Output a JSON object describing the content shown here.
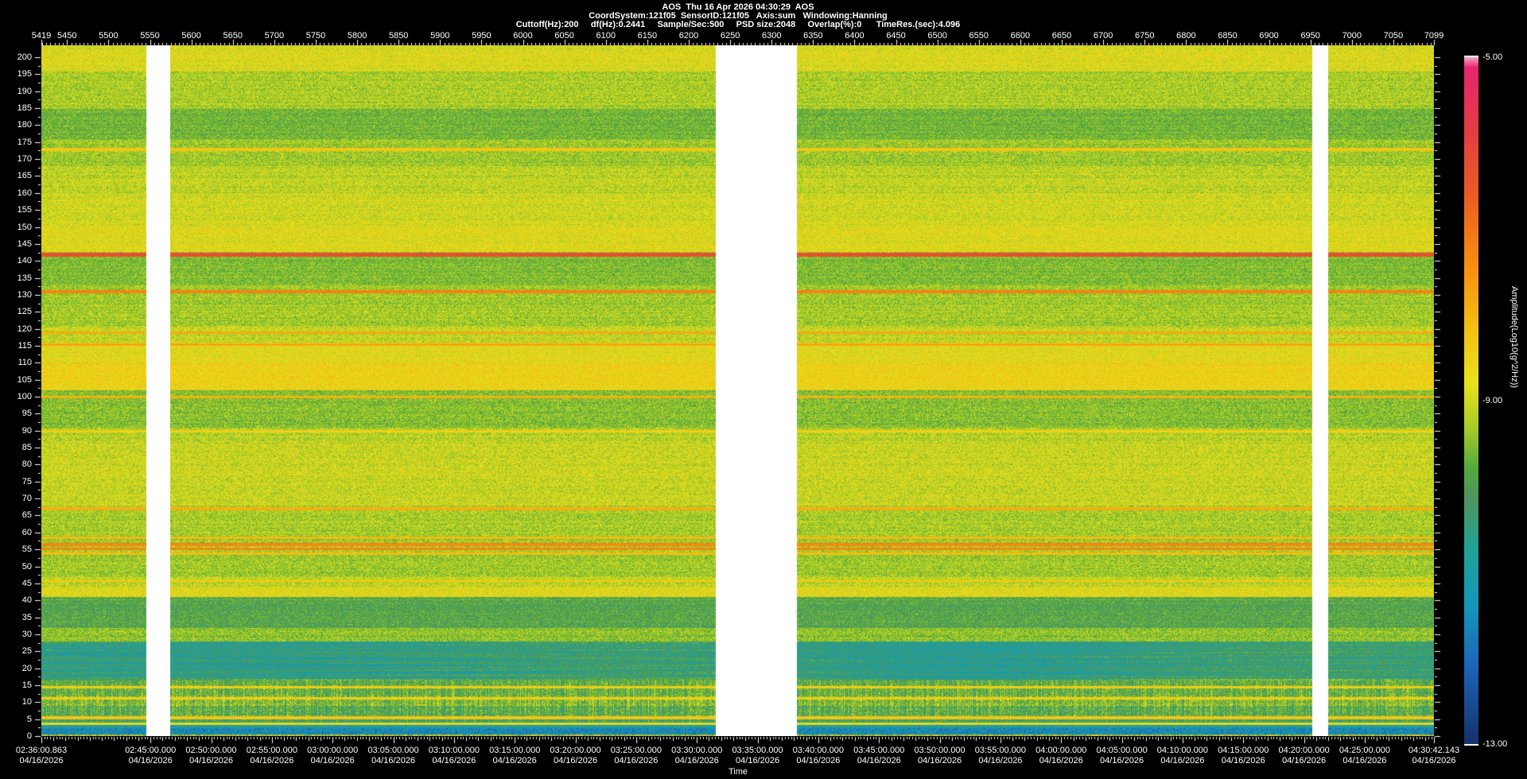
{
  "header": {
    "line1": "AOS  Thu 16 Apr 2026 04:30:29  AOS",
    "line2": "CoordSystem:121f05  SensorID:121f05   Axis:sum   Windowing:Hanning",
    "line3": "Cuttoff(Hz):200     df(Hz):0.2441     Sample/Sec:500     PSD size:2048     Overlap(%):0      TimeRes.(sec):4.096"
  },
  "chart_data": {
    "type": "heatmap",
    "title": "AOS  Thu 16 Apr 2026 04:30:29  AOS",
    "x_axis_top": {
      "min": 5419,
      "max": 7099,
      "labels": [
        5419,
        5450,
        5500,
        5550,
        5600,
        5650,
        5700,
        5750,
        5800,
        5850,
        5900,
        5950,
        6000,
        6050,
        6100,
        6150,
        6200,
        6250,
        6300,
        6350,
        6400,
        6450,
        6500,
        6550,
        6600,
        6650,
        6700,
        6750,
        6800,
        6850,
        6900,
        6950,
        7000,
        7050,
        7099
      ]
    },
    "y_axis": {
      "min": 0,
      "max": 200,
      "labels": [
        200,
        195,
        190,
        185,
        180,
        175,
        170,
        165,
        160,
        155,
        150,
        145,
        140,
        135,
        130,
        125,
        120,
        115,
        110,
        105,
        100,
        95,
        90,
        85,
        80,
        75,
        70,
        65,
        60,
        55,
        50,
        45,
        40,
        35,
        30,
        25,
        20,
        15,
        10,
        5,
        0
      ]
    },
    "x_axis_bottom": {
      "label": "Time",
      "date": "04/16/2026",
      "start_sec": 9360.863,
      "end_sec": 16242.143,
      "tick_labels": [
        {
          "time": "02:36:00.863",
          "sec": 9360.863
        },
        {
          "time": "02:45:00.000",
          "sec": 9900
        },
        {
          "time": "02:50:00.000",
          "sec": 10200
        },
        {
          "time": "02:55:00.000",
          "sec": 10500
        },
        {
          "time": "03:00:00.000",
          "sec": 10800
        },
        {
          "time": "03:05:00.000",
          "sec": 11100
        },
        {
          "time": "03:10:00.000",
          "sec": 11400
        },
        {
          "time": "03:15:00.000",
          "sec": 11700
        },
        {
          "time": "03:20:00.000",
          "sec": 12000
        },
        {
          "time": "03:25:00.000",
          "sec": 12300
        },
        {
          "time": "03:30:00.000",
          "sec": 12600
        },
        {
          "time": "03:35:00.000",
          "sec": 12900
        },
        {
          "time": "03:40:00.000",
          "sec": 13200
        },
        {
          "time": "03:45:00.000",
          "sec": 13500
        },
        {
          "time": "03:50:00.000",
          "sec": 13800
        },
        {
          "time": "03:55:00.000",
          "sec": 14100
        },
        {
          "time": "04:00:00.000",
          "sec": 14400
        },
        {
          "time": "04:05:00.000",
          "sec": 14700
        },
        {
          "time": "04:10:00.000",
          "sec": 15000
        },
        {
          "time": "04:15:00.000",
          "sec": 15300
        },
        {
          "time": "04:20:00.000",
          "sec": 15600
        },
        {
          "time": "04:25:00.000",
          "sec": 15900
        },
        {
          "time": "04:30:42.143",
          "sec": 16242.143
        }
      ]
    },
    "colorbar": {
      "label": "Amplitude(Log10(g^2/Hz))",
      "max": -5,
      "min": -13,
      "tick_labels": [
        "-5.00",
        "-9.00",
        "-13.00"
      ],
      "stops": [
        [
          -13.0,
          "#15316b"
        ],
        [
          -12.1,
          "#1d64b8"
        ],
        [
          -11.4,
          "#1495bb"
        ],
        [
          -10.7,
          "#23a295"
        ],
        [
          -10.15,
          "#4f9260"
        ],
        [
          -9.8,
          "#50aa3c"
        ],
        [
          -9.3,
          "#a8cc28"
        ],
        [
          -8.8,
          "#e8e01e"
        ],
        [
          -8.2,
          "#f2c213"
        ],
        [
          -7.4,
          "#f68c10"
        ],
        [
          -6.6,
          "#ea5c24"
        ],
        [
          -5.8,
          "#e43a46"
        ],
        [
          -5.12,
          "#e8246e"
        ],
        [
          -5.0,
          "#f2a6c4"
        ]
      ]
    },
    "gaps": [
      [
        0.0754,
        0.0925
      ],
      [
        0.4843,
        0.5426
      ],
      [
        0.9126,
        0.924
      ]
    ],
    "bands": [
      [
        203.5,
        196,
        -8.85,
        0.5
      ],
      [
        196,
        185,
        -9.25,
        0.5
      ],
      [
        185,
        176,
        -9.65,
        0.45
      ],
      [
        176,
        168,
        -9.3,
        0.5
      ],
      [
        168,
        160,
        -9.1,
        0.5
      ],
      [
        160,
        150,
        -8.95,
        0.5
      ],
      [
        150,
        142.8,
        -8.8,
        0.5
      ],
      [
        142.8,
        133,
        -9.55,
        0.45
      ],
      [
        133,
        121,
        -9.3,
        0.5
      ],
      [
        121,
        116,
        -9.05,
        0.5
      ],
      [
        116,
        110,
        -8.75,
        0.5
      ],
      [
        110,
        102,
        -8.5,
        0.5
      ],
      [
        102,
        91,
        -9.5,
        0.5
      ],
      [
        91,
        87,
        -9.15,
        0.5
      ],
      [
        87,
        68,
        -9.0,
        0.55
      ],
      [
        68,
        60,
        -9.25,
        0.5
      ],
      [
        60,
        47,
        -9.3,
        0.5
      ],
      [
        47,
        44,
        -9.05,
        0.5
      ],
      [
        44,
        41,
        -8.8,
        0.5
      ],
      [
        41,
        32,
        -9.9,
        0.5
      ],
      [
        32,
        28,
        -9.45,
        0.5
      ],
      [
        28,
        17,
        -10.5,
        0.6
      ],
      [
        17,
        15,
        -9.85,
        0.55
      ],
      [
        15,
        12,
        -9.75,
        0.6
      ],
      [
        12,
        9,
        -9.55,
        0.65
      ],
      [
        9,
        6,
        -9.9,
        0.65
      ],
      [
        6,
        4,
        -10.25,
        0.6
      ],
      [
        4,
        2.5,
        -10.9,
        0.7
      ],
      [
        2.5,
        0.7,
        -11.5,
        0.8
      ],
      [
        0.7,
        0,
        -9.2,
        1.6
      ]
    ],
    "lines": [
      [
        173,
        -8.3,
        0.45
      ],
      [
        142,
        -6.3,
        0.55
      ],
      [
        131,
        -7.3,
        0.45
      ],
      [
        119,
        -7.85,
        0.3
      ],
      [
        115.5,
        -7.8,
        0.3
      ],
      [
        100,
        -7.95,
        0.35
      ],
      [
        90,
        -8.45,
        0.35
      ],
      [
        67,
        -7.95,
        0.45
      ],
      [
        58.5,
        -8.05,
        0.4
      ],
      [
        56.6,
        -7.3,
        0.4
      ],
      [
        55.2,
        -7.4,
        0.35
      ],
      [
        53.8,
        -8.1,
        0.3
      ],
      [
        45.8,
        -8.45,
        0.3
      ],
      [
        14.5,
        -8.5,
        0.4
      ],
      [
        11.3,
        -8.5,
        0.4
      ],
      [
        5.5,
        -8.3,
        0.5
      ],
      [
        3.8,
        -8.75,
        0.3
      ]
    ]
  }
}
